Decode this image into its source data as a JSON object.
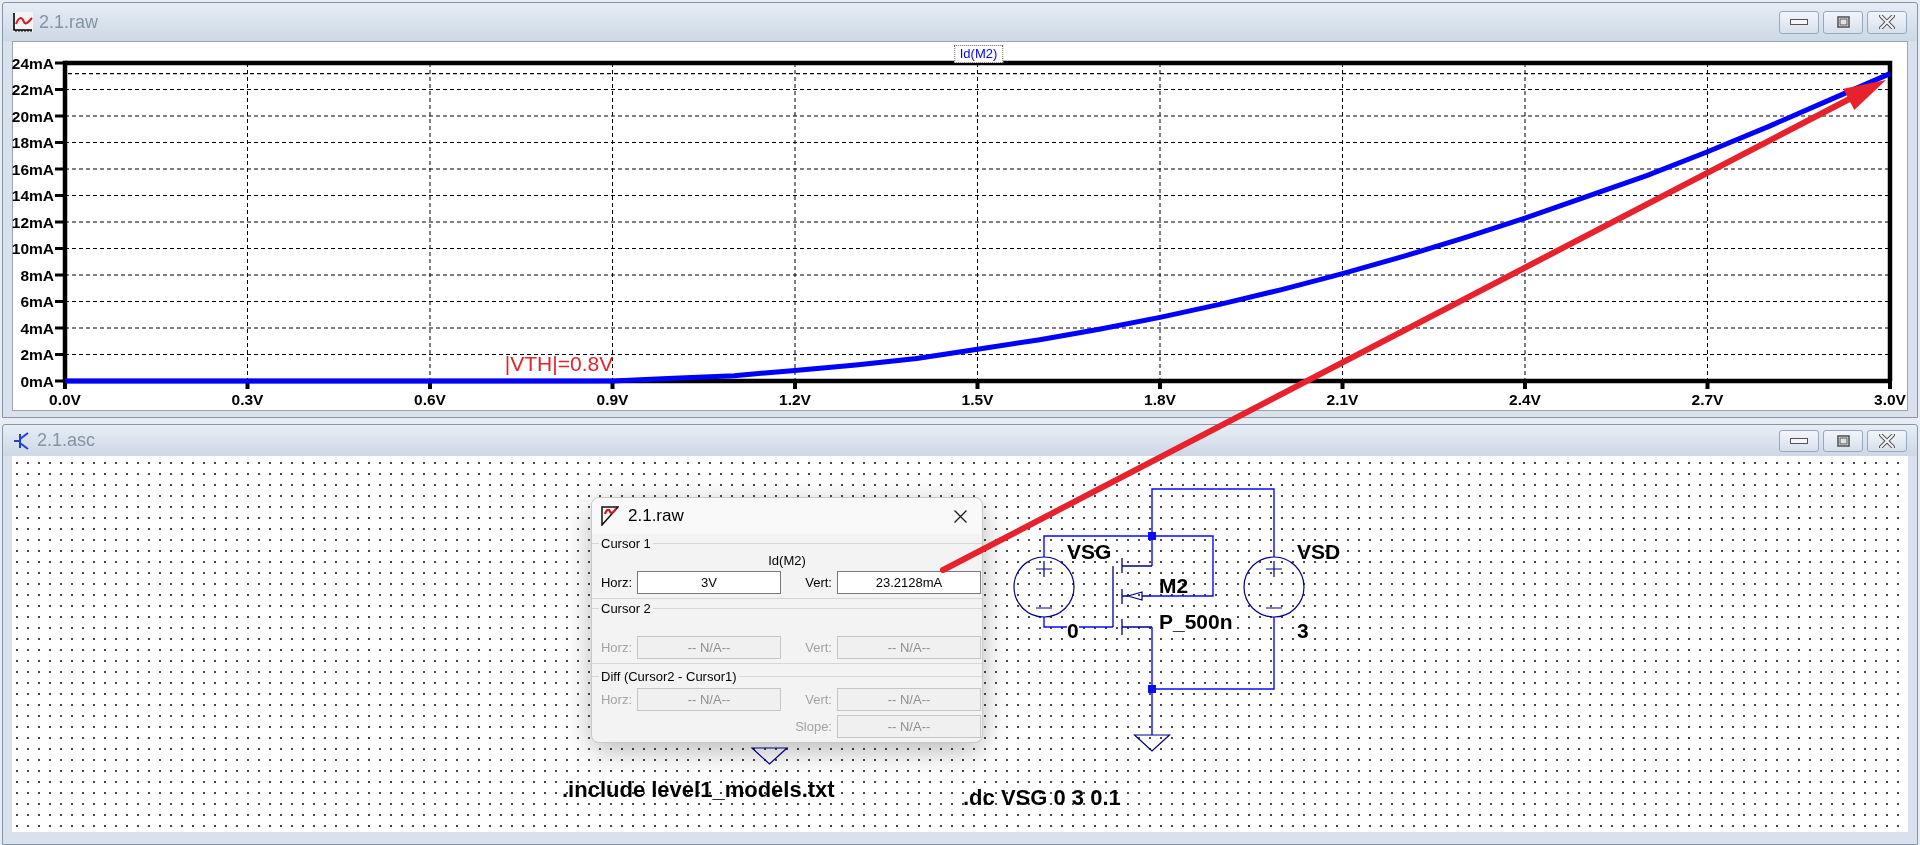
{
  "plot_window": {
    "title": "2.1.raw",
    "chart_data": {
      "type": "line",
      "title": "Id(M2)",
      "x": [
        0,
        0.1,
        0.2,
        0.3,
        0.4,
        0.5,
        0.6,
        0.7,
        0.8,
        0.9,
        1,
        1.1,
        1.2,
        1.3,
        1.4,
        1.5,
        1.6,
        1.7,
        1.8,
        1.9,
        2,
        2.1,
        2.2,
        2.3,
        2.4,
        2.5,
        2.6,
        2.7,
        2.8,
        2.9,
        3
      ],
      "series": [
        {
          "color": "#0000ff",
          "values": [
            0,
            0,
            0,
            0,
            0,
            0,
            0,
            0,
            0,
            0,
            0.2,
            0.4,
            0.8,
            1.2,
            1.7,
            2.4,
            3.1,
            3.9,
            4.8,
            5.8,
            6.9,
            8.1,
            9.4,
            10.8,
            12.3,
            13.9,
            15.5,
            17.3,
            19.2,
            21.2,
            23.2
          ]
        }
      ],
      "xlim": [
        0,
        3
      ],
      "ylim": [
        0,
        24
      ],
      "xticks": [
        {
          "value": 0,
          "label": "0.0V"
        },
        {
          "value": 0.3,
          "label": "0.3V"
        },
        {
          "value": 0.6,
          "label": "0.6V"
        },
        {
          "value": 0.9,
          "label": "0.9V"
        },
        {
          "value": 1.2,
          "label": "1.2V"
        },
        {
          "value": 1.5,
          "label": "1.5V"
        },
        {
          "value": 1.8,
          "label": "1.8V"
        },
        {
          "value": 2.1,
          "label": "2.1V"
        },
        {
          "value": 2.4,
          "label": "2.4V"
        },
        {
          "value": 2.7,
          "label": "2.7V"
        },
        {
          "value": 3,
          "label": "3.0V"
        }
      ],
      "yticks": [
        {
          "value": 0,
          "label": "0mA"
        },
        {
          "value": 2,
          "label": "2mA"
        },
        {
          "value": 4,
          "label": "4mA"
        },
        {
          "value": 6,
          "label": "6mA"
        },
        {
          "value": 8,
          "label": "8mA"
        },
        {
          "value": 10,
          "label": "10mA"
        },
        {
          "value": 12,
          "label": "12mA"
        },
        {
          "value": 14,
          "label": "14mA"
        },
        {
          "value": 16,
          "label": "16mA"
        },
        {
          "value": 18,
          "label": "18mA"
        },
        {
          "value": 20,
          "label": "20mA"
        },
        {
          "value": 22,
          "label": "22mA"
        },
        {
          "value": 24,
          "label": "24mA"
        }
      ],
      "grid": true,
      "annotations": [
        "|VTH|=0.8V"
      ]
    }
  },
  "schematic_window": {
    "title": "2.1.asc",
    "components": [
      {
        "kind": "voltage_source",
        "name": "VSG",
        "value": "0"
      },
      {
        "kind": "pmos",
        "name": "M2",
        "model": "P_500n"
      },
      {
        "kind": "voltage_source",
        "name": "VSD",
        "value": "3"
      }
    ],
    "directives": [
      ".include level1_models.txt",
      ".dc VSG 0 3 0.1"
    ]
  },
  "cursor_dialog": {
    "title": "2.1.raw",
    "groups": [
      {
        "kind": "cursor",
        "label": "Cursor 1",
        "trace": "Id(M2)",
        "rows": [
          [
            {
              "label": "Horz:",
              "value": "3V",
              "disabled": false
            },
            {
              "label": "Vert:",
              "value": "23.2128mA",
              "disabled": false
            }
          ]
        ]
      },
      {
        "kind": "cursor",
        "label": "Cursor 2",
        "rows": [
          [
            {
              "label": "Horz:",
              "value": "-- N/A--",
              "disabled": true
            },
            {
              "label": "Vert:",
              "value": "-- N/A--",
              "disabled": true
            }
          ]
        ]
      },
      {
        "kind": "diff",
        "label": "Diff (Cursor2 - Cursor1)",
        "rows": [
          [
            {
              "label": "Horz:",
              "value": "-- N/A--",
              "disabled": true
            },
            {
              "label": "Vert:",
              "value": "-- N/A--",
              "disabled": true
            }
          ],
          [
            "",
            {
              "label": "Slope:",
              "value": "-- N/A--",
              "disabled": true
            }
          ]
        ]
      }
    ]
  }
}
